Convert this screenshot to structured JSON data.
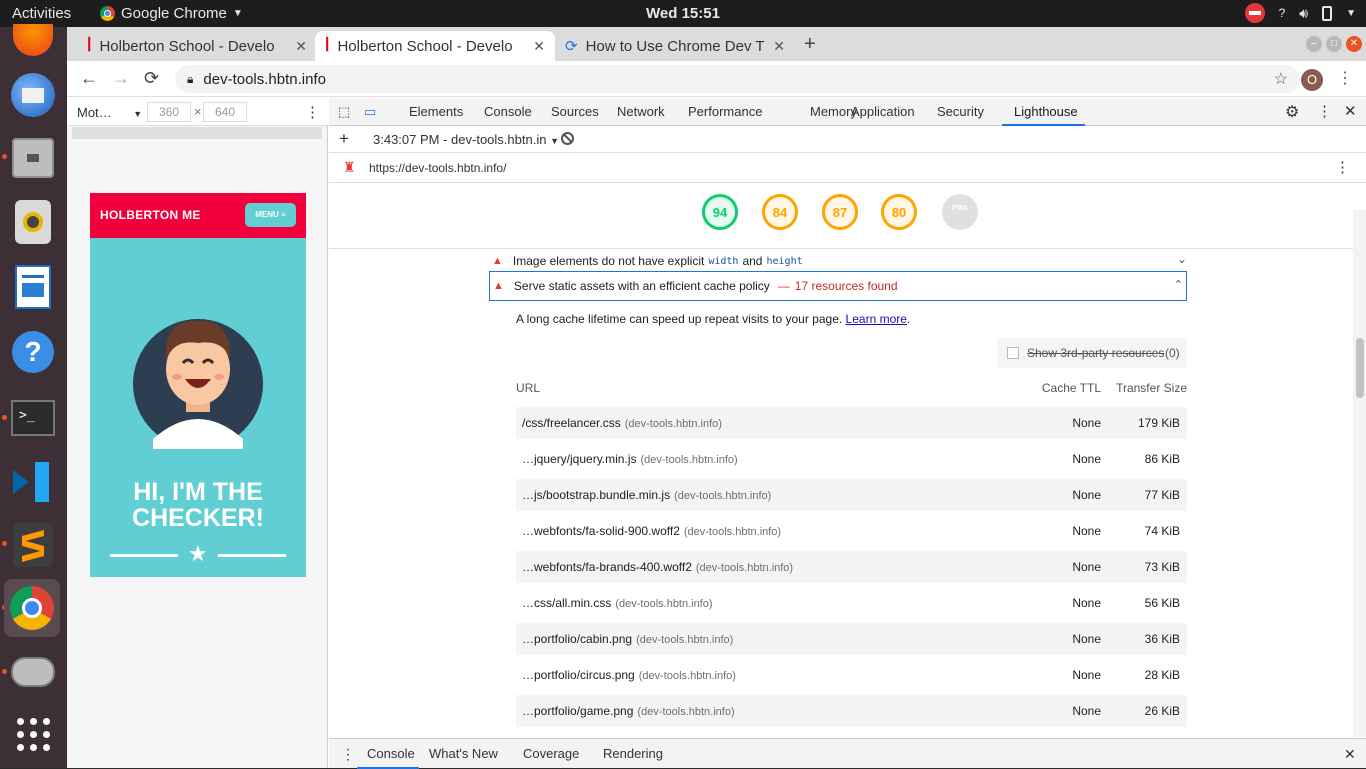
{
  "topbar": {
    "activities": "Activities",
    "app_name": "Google Chrome",
    "clock": "Wed 15:51",
    "help_glyph": "?"
  },
  "dock": {
    "items": [
      "firefox",
      "thunderbird",
      "files",
      "rhythmbox",
      "writer",
      "help",
      "terminal",
      "vscode",
      "sublime",
      "chrome",
      "scanner",
      "app-grid"
    ]
  },
  "browser": {
    "tabs": [
      {
        "title": "Holberton School - Develo",
        "active": false
      },
      {
        "title": "Holberton School - Develo",
        "active": true
      },
      {
        "title": "How to Use Chrome Dev T",
        "active": false
      }
    ],
    "url": "dev-tools.hbtn.info",
    "avatar_letter": "O"
  },
  "device_toolbar": {
    "device": "Mot…",
    "width": "360",
    "height": "640",
    "times": "×"
  },
  "phone": {
    "brand": "HOLBERTON ME",
    "menu": "MENU ≡",
    "title_line1": "HI, I'M THE",
    "title_line2": "CHECKER!"
  },
  "devtools": {
    "tabs": [
      "Elements",
      "Console",
      "Sources",
      "Network",
      "Performance",
      "Memory",
      "Application",
      "Security",
      "Lighthouse"
    ],
    "active_tab": "Lighthouse",
    "report_select": "3:43:07 PM - dev-tools.hbtn.in",
    "report_url": "https://dev-tools.hbtn.info/",
    "scores": [
      {
        "value": "94",
        "color": "#0cce6b"
      },
      {
        "value": "84",
        "color": "#ffa400"
      },
      {
        "value": "87",
        "color": "#ffa400"
      },
      {
        "value": "80",
        "color": "#ffa400"
      },
      {
        "value": "PWA",
        "color": "#9e9e9e"
      }
    ]
  },
  "audits": {
    "image_row": {
      "text_before": "Image elements do not have explicit",
      "code1": "width",
      "and": "and",
      "code2": "height"
    },
    "cache_row": {
      "title": "Serve static assets with an efficient cache policy",
      "dash": "—",
      "found": "17 resources found"
    },
    "description": "A long cache lifetime can speed up repeat visits to your page.",
    "learn_more": "Learn more",
    "description_end": ".",
    "third_party": "Show 3rd-party resources",
    "third_party_count": "(0)",
    "columns": {
      "url": "URL",
      "ttl": "Cache TTL",
      "size": "Transfer Size"
    },
    "rows": [
      {
        "url": "/css/freelancer.css",
        "host": "(dev-tools.hbtn.info)",
        "ttl": "None",
        "size": "179 KiB"
      },
      {
        "url": "…jquery/jquery.min.js",
        "host": "(dev-tools.hbtn.info)",
        "ttl": "None",
        "size": "86 KiB"
      },
      {
        "url": "…js/bootstrap.bundle.min.js",
        "host": "(dev-tools.hbtn.info)",
        "ttl": "None",
        "size": "77 KiB"
      },
      {
        "url": "…webfonts/fa-solid-900.woff2",
        "host": "(dev-tools.hbtn.info)",
        "ttl": "None",
        "size": "74 KiB"
      },
      {
        "url": "…webfonts/fa-brands-400.woff2",
        "host": "(dev-tools.hbtn.info)",
        "ttl": "None",
        "size": "73 KiB"
      },
      {
        "url": "…css/all.min.css",
        "host": "(dev-tools.hbtn.info)",
        "ttl": "None",
        "size": "56 KiB"
      },
      {
        "url": "…portfolio/cabin.png",
        "host": "(dev-tools.hbtn.info)",
        "ttl": "None",
        "size": "36 KiB"
      },
      {
        "url": "…portfolio/circus.png",
        "host": "(dev-tools.hbtn.info)",
        "ttl": "None",
        "size": "28 KiB"
      },
      {
        "url": "…portfolio/game.png",
        "host": "(dev-tools.hbtn.info)",
        "ttl": "None",
        "size": "26 KiB"
      }
    ]
  },
  "drawer": {
    "tabs": [
      "Console",
      "What's New",
      "Coverage",
      "Rendering"
    ],
    "active": "Console"
  }
}
